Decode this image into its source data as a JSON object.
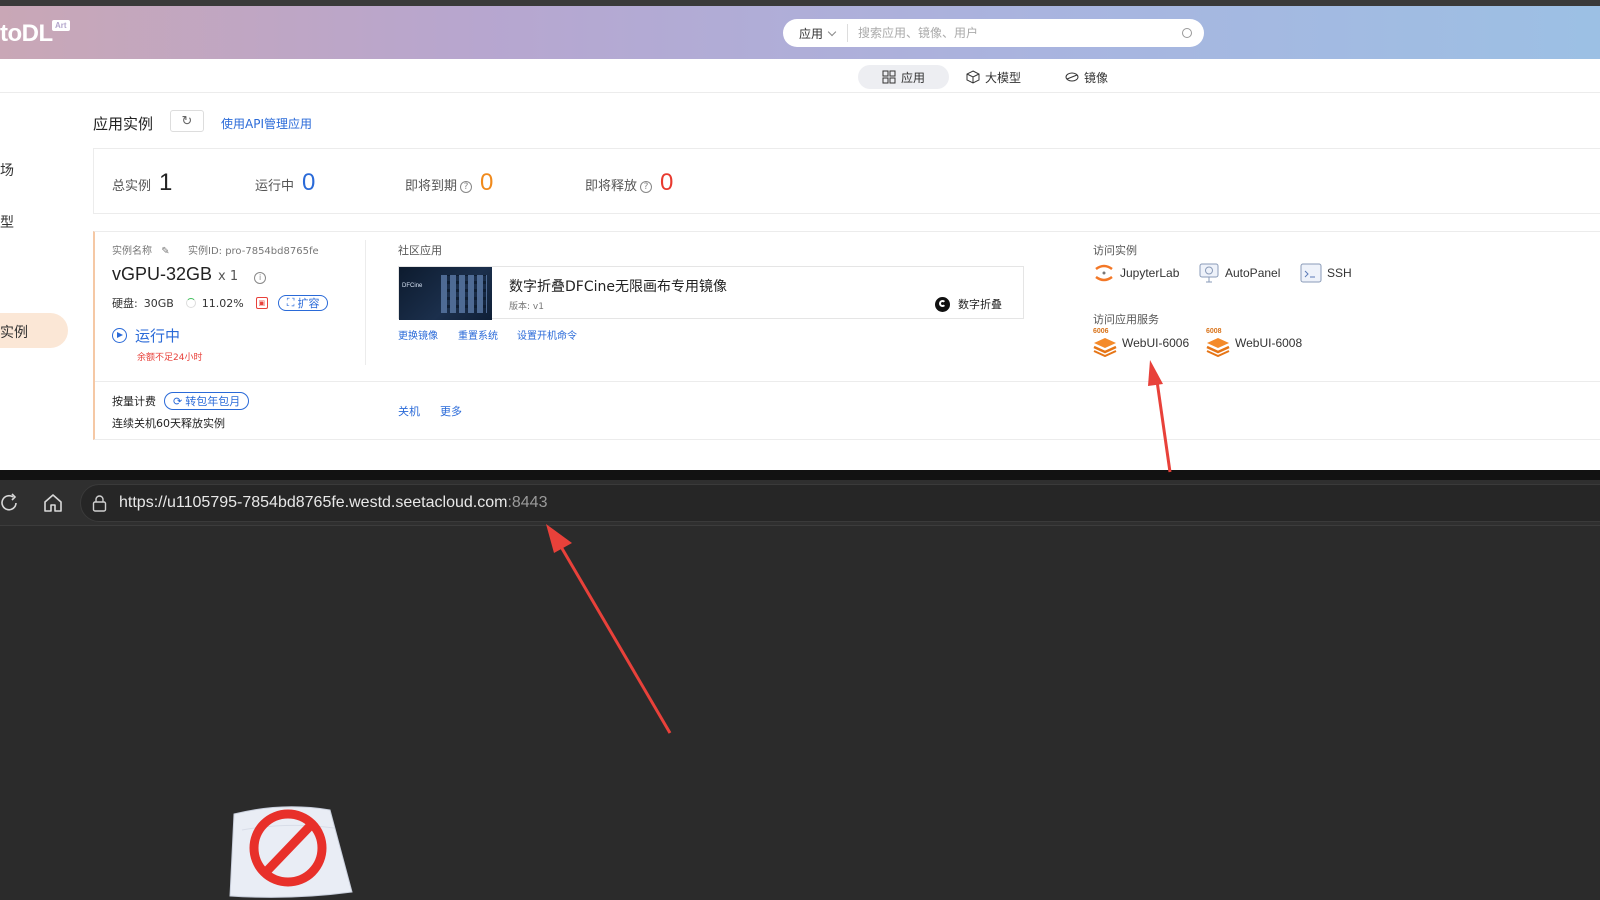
{
  "header": {
    "logo": "toDL",
    "logo_sup": "Art",
    "search_select": "应用",
    "search_placeholder": "搜索应用、镜像、用户"
  },
  "nav": {
    "tabs": [
      {
        "label": "应用",
        "icon": "grid-icon",
        "active": true
      },
      {
        "label": "大模型",
        "icon": "cube-icon",
        "active": false
      },
      {
        "label": "镜像",
        "icon": "disc-icon",
        "active": false
      }
    ]
  },
  "sidebar": {
    "items": [
      "广场",
      "模型",
      "实例"
    ],
    "active": "实例"
  },
  "main": {
    "title": "应用实例",
    "refresh_icon": "↻",
    "api_link": "使用API管理应用",
    "stats": [
      {
        "label": "总实例",
        "value": "1",
        "color": "#222222",
        "help": false
      },
      {
        "label": "运行中",
        "value": "0",
        "color": "#2a6ad8",
        "help": false
      },
      {
        "label": "即将到期",
        "value": "0",
        "color": "#f08a1c",
        "help": true
      },
      {
        "label": "即将释放",
        "value": "0",
        "color": "#e83a2f",
        "help": true
      }
    ]
  },
  "instance": {
    "name_label": "实例名称",
    "id_text": "实例ID: pro-7854bd8765fe",
    "gpu": "vGPU-32GB",
    "gpu_count": "x 1",
    "disk_label": "硬盘:",
    "disk_value": "30GB",
    "disk_usage": "11.02%",
    "expand_label": "扩容",
    "status": "运行中",
    "balance_warning": "余额不足24小时",
    "billing_label": "按量计费",
    "convert_label": "转包年包月",
    "release_note": "连续关机60天释放实例",
    "community_label": "社区应用",
    "app_title": "数字折叠DFCine无限画布专用镜像",
    "app_version": "版本: v1",
    "app_author": "数字折叠",
    "thumb_text": "DFCine",
    "actions": [
      "更换镜像",
      "重置系统",
      "设置开机命令"
    ],
    "power_actions": [
      "关机",
      "更多"
    ],
    "access_label": "访问实例",
    "access_items": [
      "JupyterLab",
      "AutoPanel",
      "SSH"
    ],
    "service_label": "访问应用服务",
    "services": [
      {
        "label": "WebUI-6006",
        "badge": "6006"
      },
      {
        "label": "WebUI-6008",
        "badge": "6008"
      }
    ]
  },
  "browser": {
    "url_main": "https://u1105795-7854bd8765fe.westd.seetacloud.com",
    "url_port": ":8443"
  },
  "colors": {
    "accent_blue": "#2a6ad8",
    "orange": "#f08a1c",
    "red": "#e83a2f",
    "arrow_red": "#e8413a"
  }
}
